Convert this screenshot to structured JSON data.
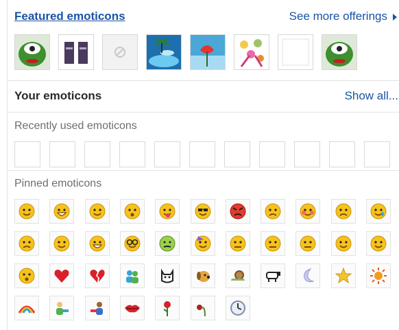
{
  "featured": {
    "title": "Featured emoticons",
    "see_more": "See more offerings",
    "packs": [
      {
        "icon": "green-monster-icon"
      },
      {
        "icon": "tiki-icon"
      },
      {
        "icon": "placeholder-icon"
      },
      {
        "icon": "island-icon"
      },
      {
        "icon": "flower-icon"
      },
      {
        "icon": "starburst-flowers-icon"
      },
      {
        "icon": "blank-icon"
      },
      {
        "icon": "green-monster-icon"
      }
    ]
  },
  "your_emoticons": {
    "title": "Your emoticons",
    "show_all": "Show all..."
  },
  "recent": {
    "title": "Recently used emoticons",
    "slot_count": 11
  },
  "pinned": {
    "title": "Pinned emoticons",
    "icons": [
      "smile-icon",
      "big-grin-icon",
      "wink-icon",
      "surprised-icon",
      "tongue-out-icon",
      "sunglasses-icon",
      "angry-icon",
      "confused-icon",
      "embarrassed-icon",
      "sad-icon",
      "crying-icon",
      "disappointed-icon",
      "nerd-smile-icon",
      "grinning-teeth-icon",
      "glasses-icon",
      "sick-icon",
      "party-icon",
      "eye-roll-icon",
      "sarcastic-icon",
      "secret-icon",
      "dont-know-icon",
      "annoyed-icon",
      "thinking-icon",
      "heart-icon",
      "broken-heart-icon",
      "friends-icon",
      "cat-icon",
      "dog-icon",
      "snail-icon",
      "sheep-icon",
      "moon-icon",
      "star-icon",
      "sun-icon",
      "rainbow-icon",
      "boy-hug-icon",
      "girl-hug-icon",
      "lips-icon",
      "rose-icon",
      "wilted-rose-icon",
      "clock-icon"
    ]
  },
  "colors": {
    "link": "#1a53a5",
    "face": "#f6c21b"
  }
}
